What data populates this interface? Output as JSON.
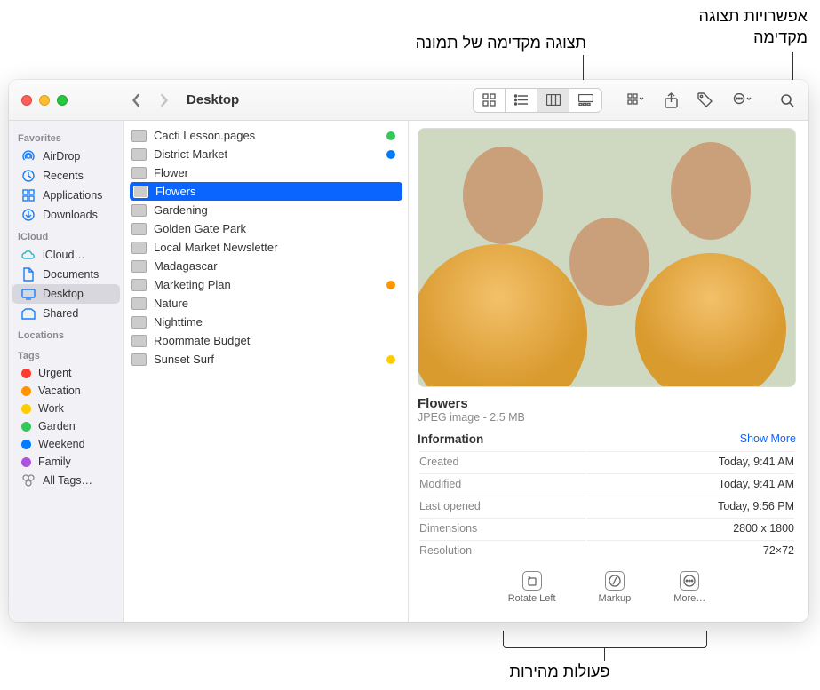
{
  "callouts": {
    "preview_image": "תצוגה מקדימה של תמונה",
    "preview_options": "אפשרויות תצוגה\nמקדימה",
    "quick_actions": "פעולות מהירות"
  },
  "window": {
    "title": "Desktop"
  },
  "sidebar": {
    "sections": [
      {
        "header": "Favorites",
        "items": [
          {
            "icon": "airdrop",
            "label": "AirDrop"
          },
          {
            "icon": "clock",
            "label": "Recents"
          },
          {
            "icon": "apps",
            "label": "Applications"
          },
          {
            "icon": "download",
            "label": "Downloads"
          }
        ]
      },
      {
        "header": "iCloud",
        "items": [
          {
            "icon": "cloud",
            "label": "iCloud…"
          },
          {
            "icon": "doc",
            "label": "Documents"
          },
          {
            "icon": "desktop",
            "label": "Desktop",
            "selected": true
          },
          {
            "icon": "shared",
            "label": "Shared"
          }
        ]
      },
      {
        "header": "Locations",
        "items": []
      },
      {
        "header": "Tags",
        "items": [
          {
            "dot": "#ff3b30",
            "label": "Urgent"
          },
          {
            "dot": "#ff9500",
            "label": "Vacation"
          },
          {
            "dot": "#ffcc00",
            "label": "Work"
          },
          {
            "dot": "#34c759",
            "label": "Garden"
          },
          {
            "dot": "#007aff",
            "label": "Weekend"
          },
          {
            "dot": "#af52de",
            "label": "Family"
          },
          {
            "icon": "alltags",
            "label": "All Tags…"
          }
        ]
      }
    ]
  },
  "files": [
    {
      "name": "Cacti Lesson.pages",
      "tag": "#34c759"
    },
    {
      "name": "District Market",
      "tag": "#007aff"
    },
    {
      "name": "Flower"
    },
    {
      "name": "Flowers",
      "selected": true
    },
    {
      "name": "Gardening"
    },
    {
      "name": "Golden Gate Park"
    },
    {
      "name": "Local Market Newsletter"
    },
    {
      "name": "Madagascar"
    },
    {
      "name": "Marketing Plan",
      "tag": "#ff9500"
    },
    {
      "name": "Nature"
    },
    {
      "name": "Nighttime"
    },
    {
      "name": "Roommate Budget"
    },
    {
      "name": "Sunset Surf",
      "tag": "#ffcc00"
    }
  ],
  "preview": {
    "title": "Flowers",
    "subtitle": "JPEG image - 2.5 MB",
    "info_header": "Information",
    "show_more": "Show More",
    "rows": [
      {
        "k": "Created",
        "v": "Today, 9:41 AM"
      },
      {
        "k": "Modified",
        "v": "Today, 9:41 AM"
      },
      {
        "k": "Last opened",
        "v": "Today, 9:56 PM"
      },
      {
        "k": "Dimensions",
        "v": "2800 x 1800"
      },
      {
        "k": "Resolution",
        "v": "72×72"
      }
    ],
    "actions": [
      {
        "icon": "rotate",
        "label": "Rotate Left"
      },
      {
        "icon": "markup",
        "label": "Markup"
      },
      {
        "icon": "more",
        "label": "More…"
      }
    ]
  }
}
